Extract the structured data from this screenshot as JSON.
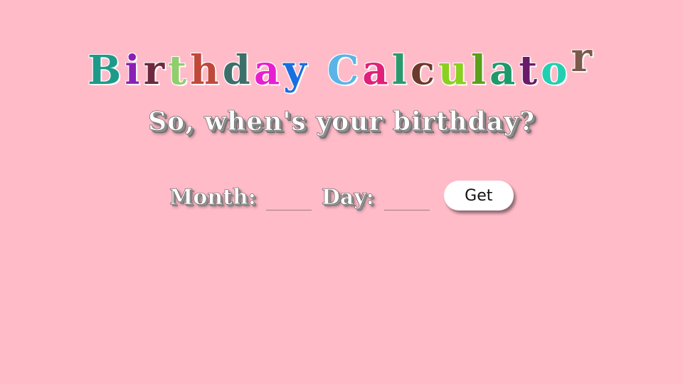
{
  "title": {
    "letters": [
      {
        "ch": "B",
        "color": "#1e9a8a"
      },
      {
        "ch": "i",
        "color": "#8a1fb5"
      },
      {
        "ch": "r",
        "color": "#6b2a3f"
      },
      {
        "ch": "t",
        "color": "#8fce6a"
      },
      {
        "ch": "h",
        "color": "#c0483a"
      },
      {
        "ch": "d",
        "color": "#3d6f6a"
      },
      {
        "ch": "a",
        "color": "#e81fd0"
      },
      {
        "ch": "y",
        "color": "#1a6fe0"
      },
      {
        "ch": " ",
        "color": ""
      },
      {
        "ch": "C",
        "color": "#5ab4e8"
      },
      {
        "ch": "a",
        "color": "#e0207a"
      },
      {
        "ch": "l",
        "color": "#2a9a6e"
      },
      {
        "ch": "c",
        "color": "#6b3a2a"
      },
      {
        "ch": "u",
        "color": "#8ad020"
      },
      {
        "ch": "l",
        "color": "#5aa01a"
      },
      {
        "ch": "a",
        "color": "#1e9a6a"
      },
      {
        "ch": "t",
        "color": "#6a1a6a"
      },
      {
        "ch": "o",
        "color": "#20d0b0"
      },
      {
        "ch": "r",
        "color": "#7a5a4a",
        "raised": true
      }
    ]
  },
  "question": "So, when's your birthday?",
  "form": {
    "month_label": "Month:",
    "month_value": "",
    "day_label": "Day:",
    "day_value": "",
    "get_label": "Get"
  }
}
